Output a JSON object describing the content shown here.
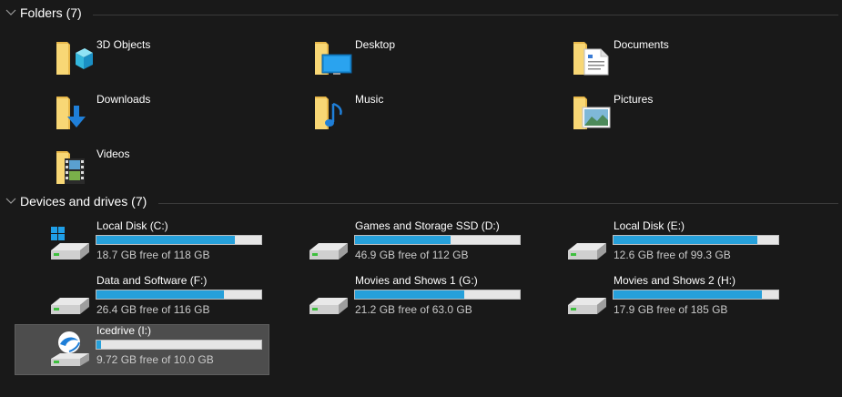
{
  "folders_group": {
    "title": "Folders (7)"
  },
  "folders": [
    {
      "label": "3D Objects",
      "icon": "3d-objects-folder-icon"
    },
    {
      "label": "Desktop",
      "icon": "desktop-folder-icon"
    },
    {
      "label": "Documents",
      "icon": "documents-folder-icon"
    },
    {
      "label": "Downloads",
      "icon": "downloads-folder-icon"
    },
    {
      "label": "Music",
      "icon": "music-folder-icon"
    },
    {
      "label": "Pictures",
      "icon": "pictures-folder-icon"
    },
    {
      "label": "Videos",
      "icon": "videos-folder-icon"
    }
  ],
  "drives_group": {
    "title": "Devices and drives (7)"
  },
  "drives": [
    {
      "name": "Local Disk (C:)",
      "free_text": "18.7 GB free of 118 GB",
      "used_fraction": 0.842,
      "icon": "windows-drive-icon"
    },
    {
      "name": "Games and Storage SSD (D:)",
      "free_text": "46.9 GB free of 112 GB",
      "used_fraction": 0.581,
      "icon": "hard-drive-icon"
    },
    {
      "name": "Local Disk (E:)",
      "free_text": "12.6 GB free of 99.3 GB",
      "used_fraction": 0.873,
      "icon": "hard-drive-icon"
    },
    {
      "name": "Data and Software (F:)",
      "free_text": "26.4 GB free of 116 GB",
      "used_fraction": 0.772,
      "icon": "hard-drive-icon"
    },
    {
      "name": "Movies and Shows 1 (G:)",
      "free_text": "21.2 GB free of 63.0 GB",
      "used_fraction": 0.663,
      "icon": "hard-drive-icon"
    },
    {
      "name": "Movies and Shows 2 (H:)",
      "free_text": "17.9 GB free of 185 GB",
      "used_fraction": 0.903,
      "icon": "hard-drive-icon"
    },
    {
      "name": "Icedrive (I:)",
      "free_text": "9.72 GB free of 10.0 GB",
      "used_fraction": 0.028,
      "icon": "icedrive-drive-icon",
      "selected": true
    }
  ],
  "colors": {
    "background": "#191919",
    "bar_fill": "#26a0da",
    "bar_track": "#e6e6e6",
    "selection": "#4d4d4d",
    "folder_yellow": "#f8d775"
  }
}
